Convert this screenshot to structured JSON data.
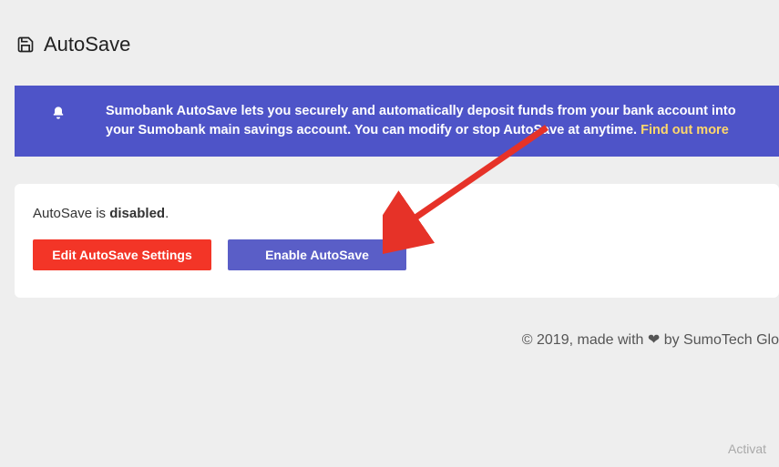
{
  "header": {
    "title": "AutoSave"
  },
  "banner": {
    "text_part1": "Sumobank AutoSave lets you securely and automatically deposit funds from your bank account into your Sumobank main savings account. You can modify or stop AutoSave at anytime. ",
    "link_label": "Find out more"
  },
  "card": {
    "status_prefix": "AutoSave is ",
    "status_value": "disabled",
    "status_suffix": ".",
    "edit_button": "Edit AutoSave Settings",
    "enable_button": "Enable AutoSave"
  },
  "footer": {
    "prefix": "© 2019, made with ",
    "suffix": " by SumoTech Glo"
  },
  "watermark": {
    "line1": "Activat"
  },
  "colors": {
    "banner_bg": "#4e54c8",
    "btn_red": "#f33527",
    "btn_purple": "#5a5ec7",
    "link": "#ffd86b",
    "arrow": "#e63228"
  }
}
